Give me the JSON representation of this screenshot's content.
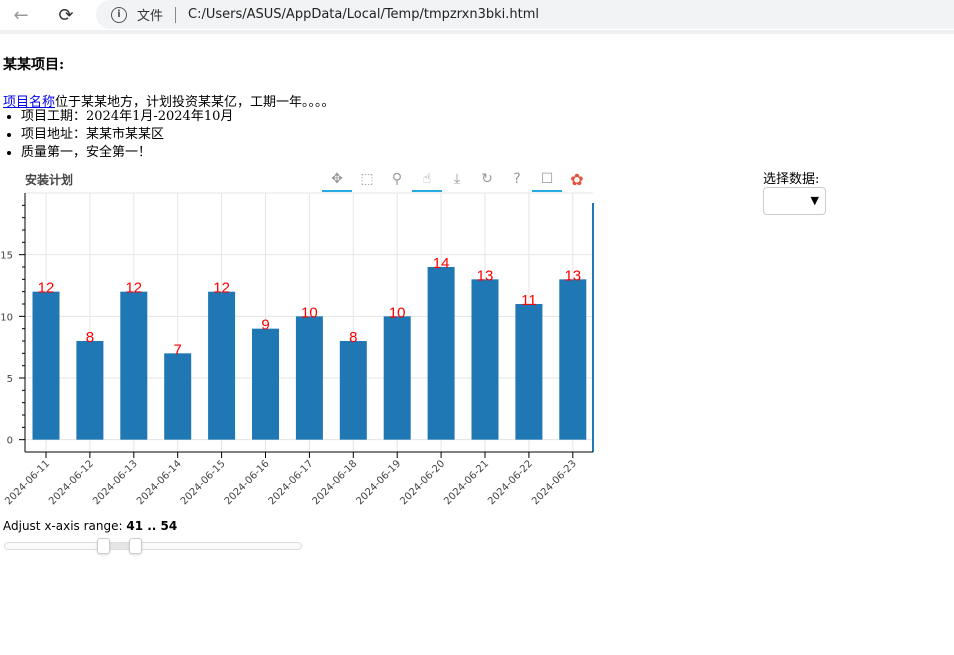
{
  "browser": {
    "back_icon": "←",
    "reload_icon": "⟳",
    "file_label": "文件",
    "url": "C:/Users/ASUS/AppData/Local/Temp/tmpzrxn3bki.html"
  },
  "page": {
    "heading": "某某项目:",
    "intro_link": "项目名称",
    "intro_text": "位于某某地方，计划投资某某亿，工期一年。。。。",
    "bullets": [
      "项目工期：2024年1月-2024年10月",
      "项目地址：某某市某某区",
      "质量第一，安全第一！"
    ]
  },
  "toolbar": {
    "icons": [
      "pan-icon",
      "box-zoom-icon",
      "wheel-zoom-icon",
      "tap-icon",
      "save-icon",
      "reset-icon",
      "help-icon",
      "hover-icon",
      "bokeh-logo-icon"
    ]
  },
  "select": {
    "label": "选择数据:",
    "value": ""
  },
  "slider": {
    "title": "Adjust x-axis range: ",
    "value_text": "41 .. 54",
    "start": 41,
    "end": 54
  },
  "chart_data": {
    "type": "bar",
    "title": "安装计划",
    "categories": [
      "2024-06-11",
      "2024-06-12",
      "2024-06-13",
      "2024-06-14",
      "2024-06-15",
      "2024-06-16",
      "2024-06-17",
      "2024-06-18",
      "2024-06-19",
      "2024-06-20",
      "2024-06-21",
      "2024-06-22",
      "2024-06-23"
    ],
    "values": [
      12,
      8,
      12,
      7,
      12,
      9,
      10,
      8,
      10,
      14,
      13,
      11,
      13
    ],
    "yticks": [
      0,
      5,
      10,
      15
    ],
    "ylim": [
      -1,
      20
    ],
    "bar_color": "#1f77b4",
    "label_color": "#ff0000",
    "grid": true
  }
}
